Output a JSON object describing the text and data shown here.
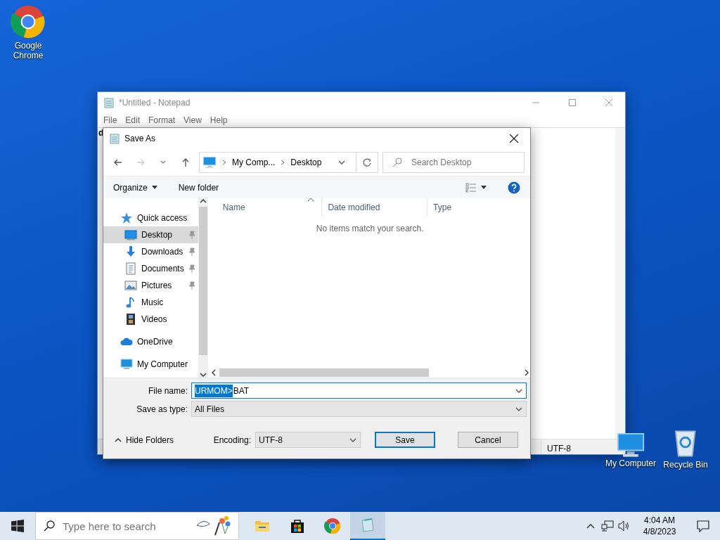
{
  "desktop_icons": [
    {
      "label": "Google Chrome",
      "kind": "chrome"
    },
    {
      "label": "My Computer",
      "kind": "computer"
    },
    {
      "label": "Recycle Bin",
      "kind": "bin"
    }
  ],
  "notepad": {
    "title": "*Untitled - Notepad",
    "menu": [
      "File",
      "Edit",
      "Format",
      "View",
      "Help"
    ],
    "text": "d",
    "status_encoding": "UTF-8"
  },
  "save_dialog": {
    "title": "Save As",
    "breadcrumb": [
      "My Comp...",
      "Desktop"
    ],
    "search": {
      "placeholder": "Search Desktop"
    },
    "toolbar": [
      "Organize",
      "New folder"
    ],
    "nav": [
      {
        "label": "Quick access",
        "kind": "star",
        "selected": false,
        "pinned": false,
        "children": [
          {
            "label": "Desktop",
            "kind": "desktop",
            "selected": true,
            "pinned": true
          },
          {
            "label": "Downloads",
            "kind": "download",
            "selected": false,
            "pinned": true
          },
          {
            "label": "Documents",
            "kind": "document",
            "selected": false,
            "pinned": true
          },
          {
            "label": "Pictures",
            "kind": "picture",
            "selected": false,
            "pinned": true
          },
          {
            "label": "Music",
            "kind": "music",
            "selected": false,
            "pinned": false
          },
          {
            "label": "Videos",
            "kind": "video",
            "selected": false,
            "pinned": false
          }
        ]
      },
      {
        "label": "OneDrive",
        "kind": "cloud",
        "selected": false,
        "pinned": false
      },
      {
        "label": "My Computer",
        "kind": "computer",
        "selected": false,
        "pinned": false
      }
    ],
    "columns": [
      "Name",
      "Date modified",
      "Type"
    ],
    "empty_message": "No items match your search.",
    "file_name": {
      "label": "File name:",
      "selected_text": "URMOM>",
      "rest_text": "BAT"
    },
    "save_type": {
      "label": "Save as type:",
      "value": "All Files"
    },
    "hide_folders": "Hide Folders",
    "encoding": {
      "label": "Encoding:",
      "value": "UTF-8"
    },
    "buttons": [
      {
        "label": "Save",
        "default": true
      },
      {
        "label": "Cancel",
        "default": false
      }
    ]
  },
  "taskbar": {
    "search": {
      "placeholder": "Type here to search"
    },
    "apps": [
      {
        "kind": "folder",
        "selected": false
      },
      {
        "kind": "store",
        "selected": false
      },
      {
        "kind": "chrome",
        "selected": false
      },
      {
        "kind": "notepad",
        "selected": true
      }
    ],
    "time": "4:04 AM",
    "date": "4/8/2023"
  }
}
